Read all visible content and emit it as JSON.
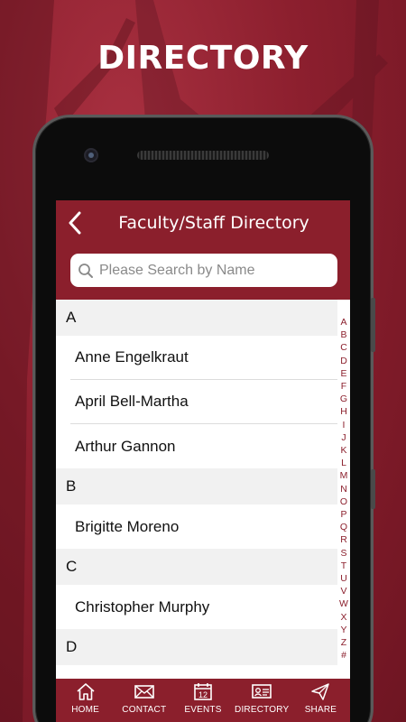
{
  "promo": {
    "title": "DIRECTORY"
  },
  "header": {
    "title": "Faculty/Staff Directory"
  },
  "search": {
    "placeholder": "Please Search by Name"
  },
  "sections": [
    {
      "letter": "A",
      "names": [
        "Anne Engelkraut",
        "April Bell-Martha",
        "Arthur Gannon"
      ]
    },
    {
      "letter": "B",
      "names": [
        "Brigitte Moreno"
      ]
    },
    {
      "letter": "C",
      "names": [
        "Christopher Murphy"
      ]
    },
    {
      "letter": "D",
      "names": [
        ""
      ]
    }
  ],
  "index": [
    "A",
    "B",
    "C",
    "D",
    "E",
    "F",
    "G",
    "H",
    "I",
    "J",
    "K",
    "L",
    "M",
    "N",
    "O",
    "P",
    "Q",
    "R",
    "S",
    "T",
    "U",
    "V",
    "W",
    "X",
    "Y",
    "Z",
    "#"
  ],
  "tabs": [
    {
      "label": "HOME",
      "icon": "home-icon"
    },
    {
      "label": "CONTACT",
      "icon": "envelope-icon"
    },
    {
      "label": "EVENTS",
      "icon": "calendar-icon"
    },
    {
      "label": "DIRECTORY",
      "icon": "id-card-icon"
    },
    {
      "label": "SHARE",
      "icon": "share-icon"
    }
  ],
  "colors": {
    "brand": "#8b1f2c",
    "section_bg": "#f1f1f1"
  }
}
